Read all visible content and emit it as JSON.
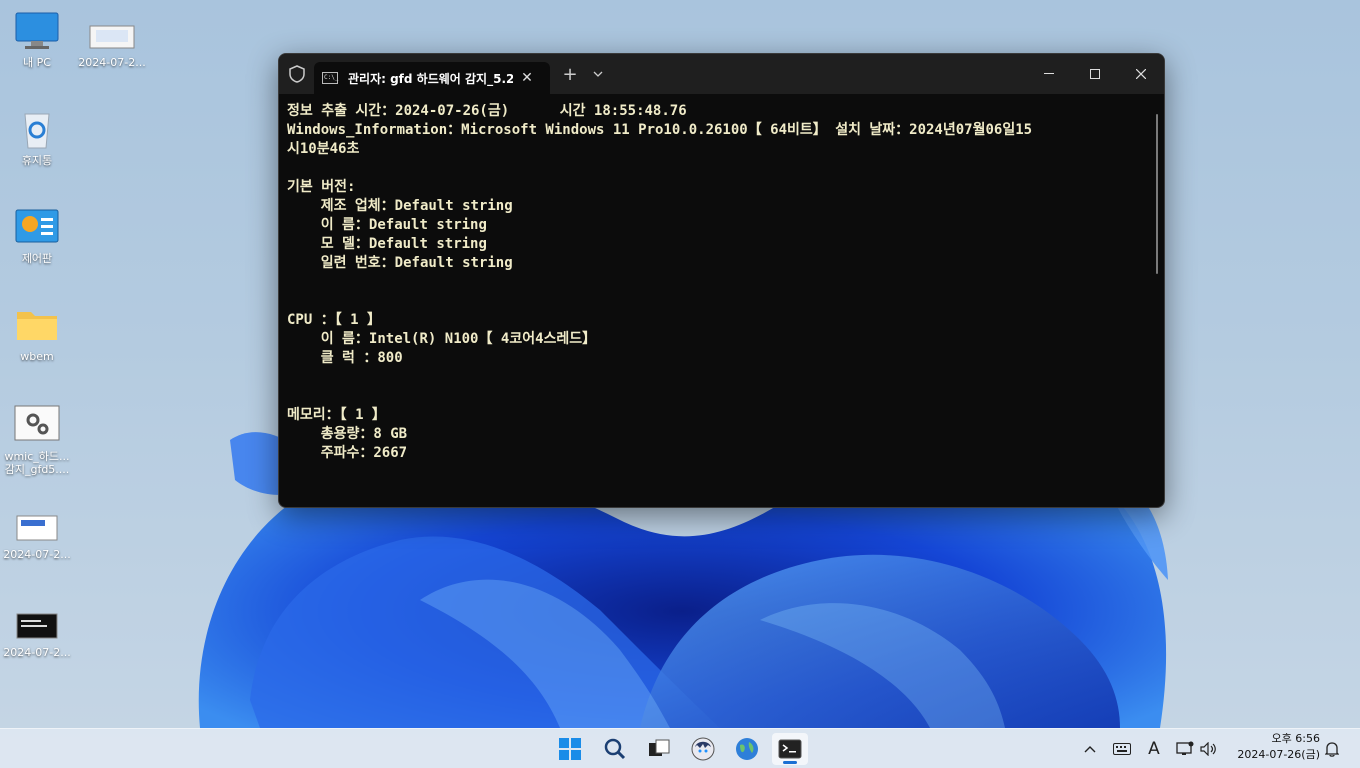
{
  "desktop": {
    "icons": [
      {
        "label": "내 PC"
      },
      {
        "label": "2024-07-2..."
      },
      {
        "label": "휴지통"
      },
      {
        "label": "제어판"
      },
      {
        "label": "wbem"
      },
      {
        "label": "wmic_하드... 감지_gfd5...."
      },
      {
        "label": "2024-07-2..."
      },
      {
        "label": "2024-07-2..."
      }
    ]
  },
  "terminal": {
    "tab_title": "관리자:  gfd 하드웨어 감지_5.2",
    "tab_close": "✕",
    "new_tab": "+",
    "dropdown": "⌄",
    "minimize": "—",
    "maximize": "☐",
    "close": "✕",
    "cmd_icon_text": "C:\\_",
    "lines": [
      "정보 추출 시간：2024-07-26(금)      시간 18:55:48.76",
      "Windows_Information：Microsoft Windows 11 Pro10.0.26100【 64비트】 설치 날짜：2024년07월06일15",
      "시10분46초",
      "",
      "기본 버전:",
      "    제조 업체：Default string",
      "    이 름：Default string",
      "    모 델：Default string",
      "    일련 번호：Default string",
      "",
      "",
      "CPU ：【 1 】",
      "    이 름：Intel(R) N100【 4코어4스레드】",
      "    클 럭 ：800",
      "",
      "",
      "메모리：【 1 】",
      "    총용량：8 GB",
      "    주파수：2667"
    ]
  },
  "taskbar": {
    "apps": [
      {
        "name": "start"
      },
      {
        "name": "search"
      },
      {
        "name": "task-view"
      },
      {
        "name": "avatar-app"
      },
      {
        "name": "globe-app"
      },
      {
        "name": "terminal-app"
      }
    ],
    "tray": {
      "chevron": "︿",
      "ime": "A"
    },
    "clock": {
      "time": "오후 6:56",
      "date": "2024-07-26(금)"
    }
  },
  "colors": {
    "console_text": "#f0ebc8",
    "console_bg": "#0c0c0c",
    "accent": "#1a6fd3"
  }
}
